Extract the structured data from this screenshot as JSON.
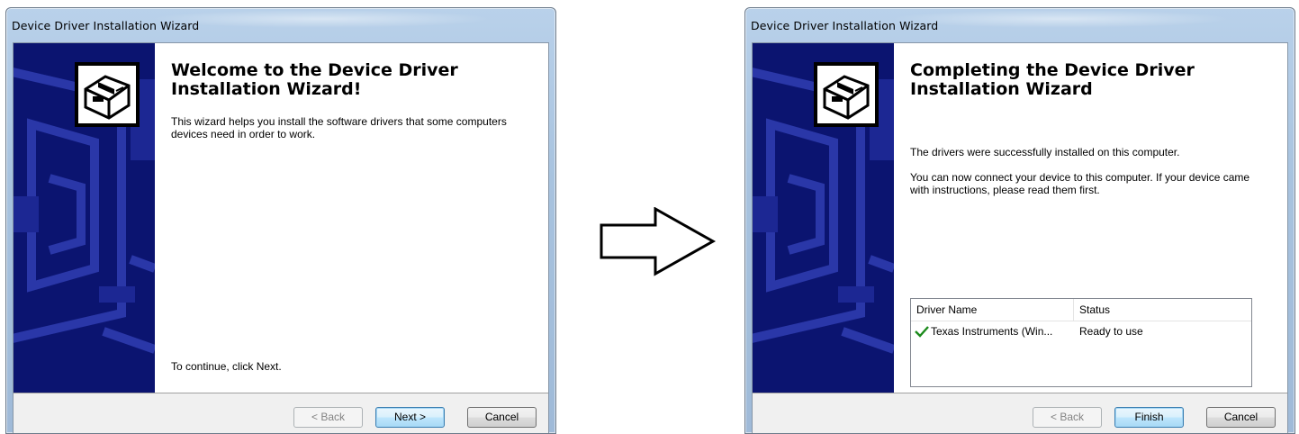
{
  "left_window": {
    "title": "Device Driver Installation Wizard",
    "heading": "Welcome to the Device Driver Installation Wizard!",
    "description": "This wizard helps you install the software drivers that some computers devices need in order to work.",
    "instruction": "To continue, click Next.",
    "buttons": {
      "back": "< Back",
      "next": "Next >",
      "cancel": "Cancel"
    }
  },
  "right_window": {
    "title": "Device Driver Installation Wizard",
    "heading": "Completing the Device Driver Installation Wizard",
    "success_text": "The drivers were successfully installed on this computer.",
    "connect_text": "You can now connect your device to this computer. If your device came with instructions, please read them first.",
    "table": {
      "columns": [
        "Driver Name",
        "Status"
      ],
      "rows": [
        {
          "name": "Texas Instruments (Win...",
          "status": "Ready to use",
          "icon": "check-icon"
        }
      ]
    },
    "buttons": {
      "back": "< Back",
      "finish": "Finish",
      "cancel": "Cancel"
    }
  },
  "colors": {
    "sidebar": "#0b1470",
    "sidebar_pattern": "#2a37a8",
    "check": "#1b8a1b"
  }
}
